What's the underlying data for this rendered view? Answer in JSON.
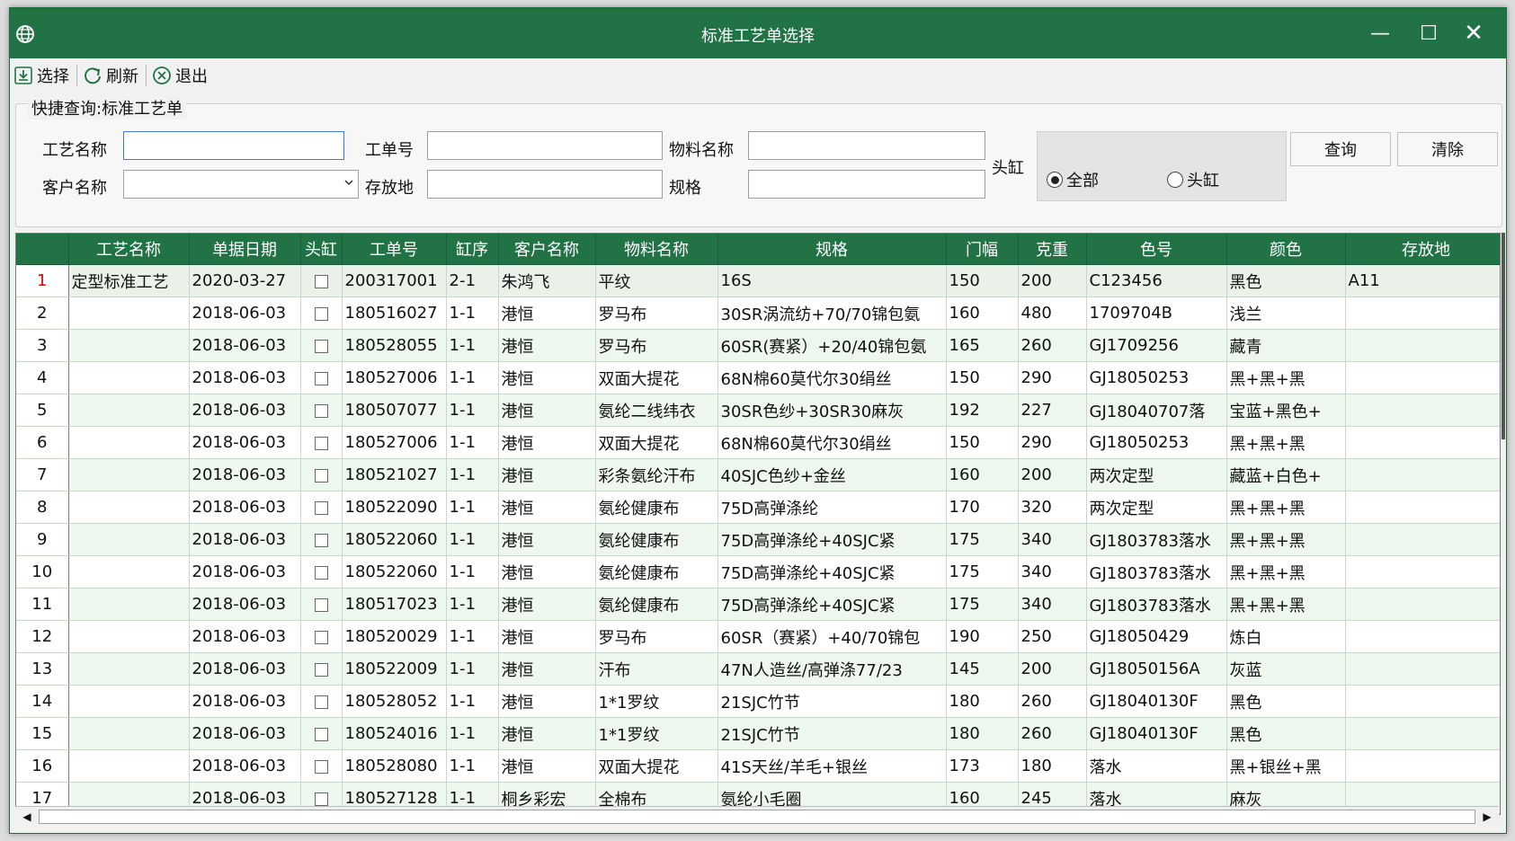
{
  "window": {
    "title": "标准工艺单选择",
    "controls": {
      "minimize": "—",
      "maximize": "☐",
      "close": "✕"
    },
    "accent_color": "#217346"
  },
  "toolbar": {
    "select_label": "选择",
    "refresh_label": "刷新",
    "exit_label": "退出"
  },
  "query": {
    "legend": "快捷查询:标准工艺单",
    "process_name_label": "工艺名称",
    "process_name_value": "",
    "order_no_label": "工单号",
    "order_no_value": "",
    "material_name_label": "物料名称",
    "material_name_value": "",
    "customer_name_label": "客户名称",
    "customer_name_value": "",
    "storage_label": "存放地",
    "storage_value": "",
    "spec_label": "规格",
    "spec_value": "",
    "head_vat_label": "头缸",
    "radio_all": "全部",
    "radio_head": "头缸",
    "radio_selected": "全部",
    "query_button": "查询",
    "clear_button": "清除"
  },
  "grid": {
    "columns": [
      "工艺名称",
      "单据日期",
      "头缸",
      "工单号",
      "缸序",
      "客户名称",
      "物料名称",
      "规格",
      "门幅",
      "克重",
      "色号",
      "颜色",
      "存放地"
    ],
    "selected_row": 1,
    "rows": [
      {
        "n": "1",
        "name": "定型标准工艺",
        "date": "2020-03-27",
        "order": "200317001",
        "seq": "2-1",
        "customer": "朱鸿飞",
        "material": "平纹",
        "spec": "16S",
        "width": "150",
        "weight": "200",
        "color_no": "C123456",
        "color": "黑色",
        "storage": "A11"
      },
      {
        "n": "2",
        "name": "",
        "date": "2018-06-03",
        "order": "180516027",
        "seq": "1-1",
        "customer": "港恒",
        "material": "罗马布",
        "spec": "30SR涡流纺+70/70锦包氨",
        "width": "160",
        "weight": "480",
        "color_no": "1709704B",
        "color": "浅兰",
        "storage": ""
      },
      {
        "n": "3",
        "name": "",
        "date": "2018-06-03",
        "order": "180528055",
        "seq": "1-1",
        "customer": "港恒",
        "material": "罗马布",
        "spec": "60SR(赛紧）+20/40锦包氨",
        "width": "165",
        "weight": "260",
        "color_no": "GJ1709256",
        "color": "藏青",
        "storage": ""
      },
      {
        "n": "4",
        "name": "",
        "date": "2018-06-03",
        "order": "180527006",
        "seq": "1-1",
        "customer": "港恒",
        "material": "双面大提花",
        "spec": "68N棉60莫代尔30绢丝",
        "width": "150",
        "weight": "290",
        "color_no": "GJ18050253",
        "color": "黑+黑+黑",
        "storage": ""
      },
      {
        "n": "5",
        "name": "",
        "date": "2018-06-03",
        "order": "180507077",
        "seq": "1-1",
        "customer": "港恒",
        "material": "氨纶二线纬衣",
        "spec": "30SR色纱+30SR30麻灰",
        "width": "192",
        "weight": "227",
        "color_no": "GJ18040707落",
        "color": "宝蓝+黑色+",
        "storage": ""
      },
      {
        "n": "6",
        "name": "",
        "date": "2018-06-03",
        "order": "180527006",
        "seq": "1-1",
        "customer": "港恒",
        "material": "双面大提花",
        "spec": "68N棉60莫代尔30绢丝",
        "width": "150",
        "weight": "290",
        "color_no": "GJ18050253",
        "color": "黑+黑+黑",
        "storage": ""
      },
      {
        "n": "7",
        "name": "",
        "date": "2018-06-03",
        "order": "180521027",
        "seq": "1-1",
        "customer": "港恒",
        "material": "彩条氨纶汗布",
        "spec": "40SJC色纱+金丝",
        "width": "160",
        "weight": "200",
        "color_no": "两次定型",
        "color": "藏蓝+白色+",
        "storage": ""
      },
      {
        "n": "8",
        "name": "",
        "date": "2018-06-03",
        "order": "180522090",
        "seq": "1-1",
        "customer": "港恒",
        "material": "氨纶健康布",
        "spec": "75D高弹涤纶",
        "width": "170",
        "weight": "320",
        "color_no": "两次定型",
        "color": "黑+黑+黑",
        "storage": ""
      },
      {
        "n": "9",
        "name": "",
        "date": "2018-06-03",
        "order": "180522060",
        "seq": "1-1",
        "customer": "港恒",
        "material": "氨纶健康布",
        "spec": "75D高弹涤纶+40SJC紧",
        "width": "175",
        "weight": "340",
        "color_no": "GJ1803783落水",
        "color": "黑+黑+黑",
        "storage": ""
      },
      {
        "n": "10",
        "name": "",
        "date": "2018-06-03",
        "order": "180522060",
        "seq": "1-1",
        "customer": "港恒",
        "material": "氨纶健康布",
        "spec": "75D高弹涤纶+40SJC紧",
        "width": "175",
        "weight": "340",
        "color_no": "GJ1803783落水",
        "color": "黑+黑+黑",
        "storage": ""
      },
      {
        "n": "11",
        "name": "",
        "date": "2018-06-03",
        "order": "180517023",
        "seq": "1-1",
        "customer": "港恒",
        "material": "氨纶健康布",
        "spec": "75D高弹涤纶+40SJC紧",
        "width": "175",
        "weight": "340",
        "color_no": "GJ1803783落水",
        "color": "黑+黑+黑",
        "storage": ""
      },
      {
        "n": "12",
        "name": "",
        "date": "2018-06-03",
        "order": "180520029",
        "seq": "1-1",
        "customer": "港恒",
        "material": "罗马布",
        "spec": "60SR（赛紧）+40/70锦包",
        "width": "190",
        "weight": "250",
        "color_no": "GJ18050429",
        "color": "炼白",
        "storage": ""
      },
      {
        "n": "13",
        "name": "",
        "date": "2018-06-03",
        "order": "180522009",
        "seq": "1-1",
        "customer": "港恒",
        "material": "汗布",
        "spec": "47N人造丝/高弹涤77/23",
        "width": "145",
        "weight": "200",
        "color_no": "GJ18050156A",
        "color": "灰蓝",
        "storage": ""
      },
      {
        "n": "14",
        "name": "",
        "date": "2018-06-03",
        "order": "180528052",
        "seq": "1-1",
        "customer": "港恒",
        "material": "1*1罗纹",
        "spec": "21SJC竹节",
        "width": "180",
        "weight": "260",
        "color_no": "GJ18040130F",
        "color": "黑色",
        "storage": ""
      },
      {
        "n": "15",
        "name": "",
        "date": "2018-06-03",
        "order": "180524016",
        "seq": "1-1",
        "customer": "港恒",
        "material": "1*1罗纹",
        "spec": "21SJC竹节",
        "width": "180",
        "weight": "260",
        "color_no": "GJ18040130F",
        "color": "黑色",
        "storage": ""
      },
      {
        "n": "16",
        "name": "",
        "date": "2018-06-03",
        "order": "180528080",
        "seq": "1-1",
        "customer": "港恒",
        "material": "双面大提花",
        "spec": "41S天丝/羊毛+银丝",
        "width": "173",
        "weight": "180",
        "color_no": "落水",
        "color": "黑+银丝+黑",
        "storage": ""
      },
      {
        "n": "17",
        "name": "",
        "date": "2018-06-03",
        "order": "180527128",
        "seq": "1-1",
        "customer": "桐乡彩宏",
        "material": "全棉布",
        "spec": "氨纶小毛圈",
        "width": "160",
        "weight": "245",
        "color_no": "落水",
        "color": "麻灰",
        "storage": ""
      }
    ]
  }
}
